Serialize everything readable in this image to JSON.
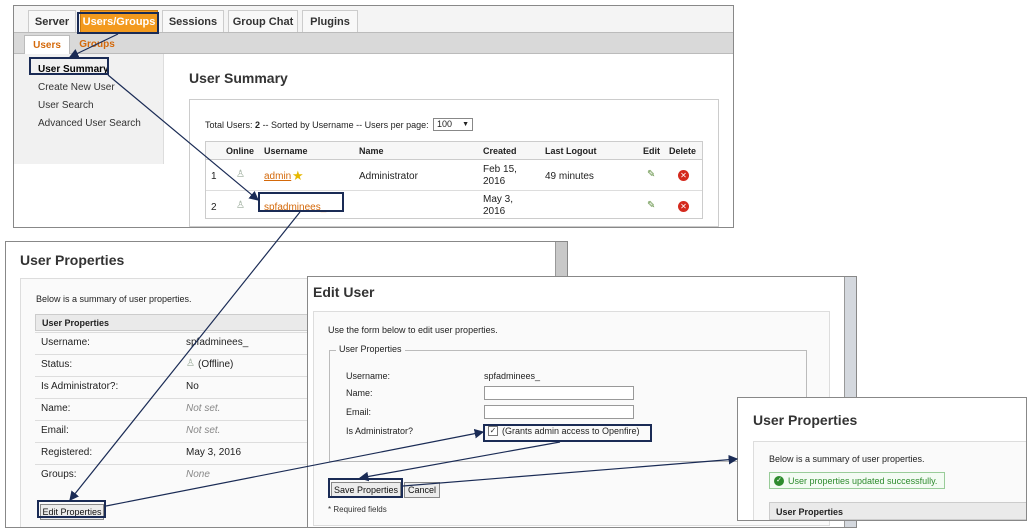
{
  "console": {
    "top_tabs": [
      "Server",
      "Users/Groups",
      "Sessions",
      "Group Chat",
      "Plugins"
    ],
    "sub_tabs": [
      "Users",
      "Groups"
    ],
    "sidebar": [
      "User Summary",
      "Create New User",
      "User Search",
      "Advanced User Search"
    ],
    "title": "User Summary",
    "summary": {
      "label_total": "Total Users:",
      "total": "2",
      "sorted_text": "-- Sorted by Username -- Users per page:",
      "per_page": "100"
    },
    "table": {
      "headers": [
        "Online",
        "Username",
        "Name",
        "Created",
        "Last Logout",
        "Edit",
        "Delete"
      ],
      "rows": [
        {
          "index": "1",
          "username": "admin",
          "name": "Administrator",
          "created": "Feb 15,\n2016",
          "last_logout": "49 minutes"
        },
        {
          "index": "2",
          "username": "spfadminees_",
          "name": "",
          "created": "May 3,\n2016",
          "last_logout": ""
        }
      ]
    }
  },
  "user_properties": {
    "title": "User Properties",
    "intro": "Below is a summary of user properties.",
    "table_header": "User Properties",
    "rows": [
      {
        "label": "Username:",
        "value": "spfadminees_"
      },
      {
        "label": "Status:",
        "value": "(Offline)"
      },
      {
        "label": "Is Administrator?:",
        "value": "No"
      },
      {
        "label": "Name:",
        "value": "Not set."
      },
      {
        "label": "Email:",
        "value": "Not set."
      },
      {
        "label": "Registered:",
        "value": "May 3, 2016"
      },
      {
        "label": "Groups:",
        "value": "None"
      }
    ],
    "edit_button": "Edit Properties"
  },
  "edit_user": {
    "title": "Edit User",
    "intro": "Use the form below to edit user properties.",
    "fieldset_legend": "User Properties",
    "fields": {
      "username_label": "Username:",
      "username_value": "spfadminees_",
      "name_label": "Name:",
      "email_label": "Email:",
      "admin_label": "Is Administrator?",
      "admin_checkbox_text": "(Grants admin access to Openfire)"
    },
    "save_button": "Save Properties",
    "cancel_button": "Cancel",
    "required_note": "* Required fields"
  },
  "success_panel": {
    "title": "User Properties",
    "intro": "Below is a summary of user properties.",
    "success_message": "User properties updated successfully.",
    "table_header": "User Properties"
  },
  "colors": {
    "accent_orange": "#f39a1e",
    "link_orange": "#d4690a",
    "highlight_navy": "#1a2b55",
    "success_green": "#2e8b2e"
  }
}
